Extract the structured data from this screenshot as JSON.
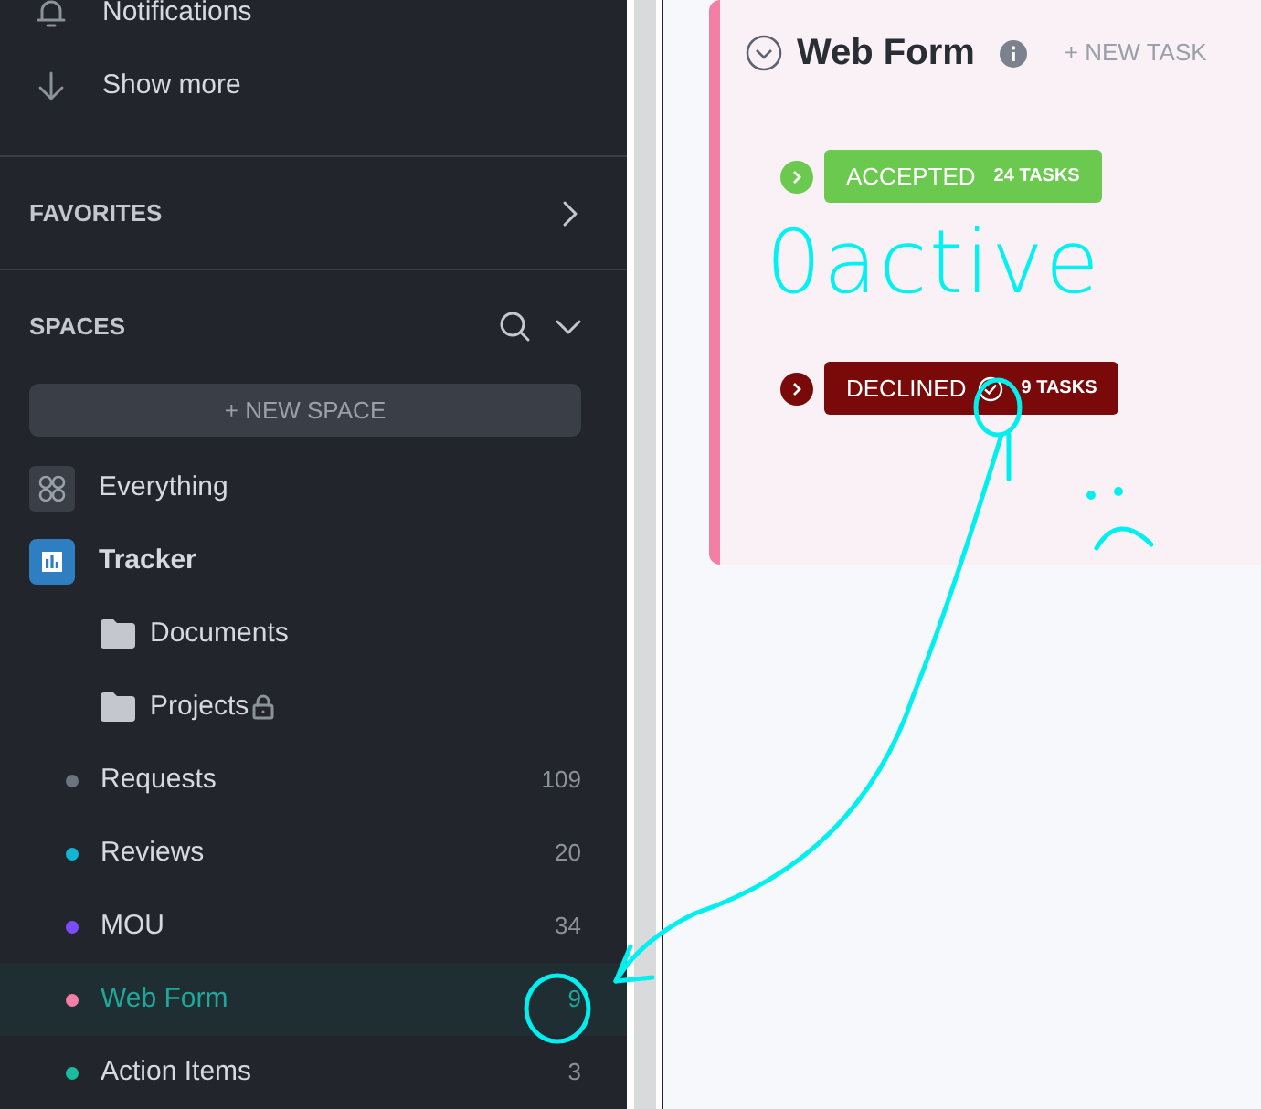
{
  "sidebar": {
    "nav_items": [
      {
        "kind": "bell",
        "label": "Notifications"
      },
      {
        "kind": "arrow",
        "label": "Show more"
      }
    ],
    "favorites": {
      "title": "FAVORITES"
    },
    "spaces": {
      "title": "SPACES",
      "new_space_button": "+ NEW SPACE",
      "items": [
        {
          "kind": "everything",
          "label": "Everything"
        },
        {
          "kind": "space",
          "label": "Tracker",
          "children": [
            {
              "kind": "folder",
              "label": "Documents",
              "locked": false
            },
            {
              "kind": "folder",
              "label": "Projects",
              "locked": true
            }
          ]
        }
      ],
      "lists": [
        {
          "label": "Requests",
          "count": "109",
          "color": "#6b7480",
          "selected": false
        },
        {
          "label": "Reviews",
          "count": "20",
          "color": "#11b6d4",
          "selected": false
        },
        {
          "label": "MOU",
          "count": "34",
          "color": "#7c4dff",
          "selected": false
        },
        {
          "label": "Web Form",
          "count": "9",
          "color": "#f47fa4",
          "selected": true
        },
        {
          "label": "Action Items",
          "count": "3",
          "color": "#1bbc9c",
          "selected": false
        }
      ]
    }
  },
  "list_view": {
    "title": "Web Form",
    "new_task": "+ NEW TASK",
    "groups": [
      {
        "status": "ACCEPTED",
        "count": "24 TASKS",
        "color": "#6bc950",
        "done": false
      },
      {
        "status": "DECLINED",
        "count": "9 TASKS",
        "color": "#7a0909",
        "done": true
      }
    ]
  },
  "annotation": {
    "text": "0active"
  }
}
